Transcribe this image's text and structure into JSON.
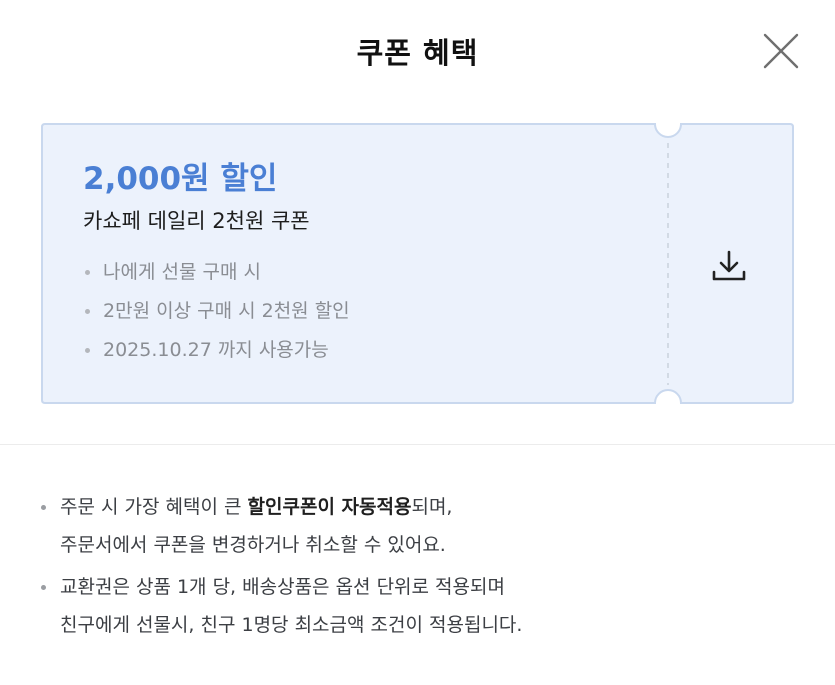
{
  "header": {
    "title": "쿠폰 혜택",
    "close_icon": "close-icon"
  },
  "coupon": {
    "amount_text": "2,000원 할인",
    "name": "카쇼페 데일리 2천원 쿠폰",
    "conditions": [
      "나에게 선물 구매 시",
      "2만원 이상 구매 시 2천원 할인",
      "2025.10.27 까지 사용가능"
    ],
    "download_icon": "download-icon",
    "colors": {
      "background": "#ecf2fc",
      "border": "#c9d8ee",
      "amount": "#4a7fd4"
    }
  },
  "notes": [
    {
      "before": "주문 시 가장 혜택이 큰 ",
      "bold": "할인쿠폰이 자동적용",
      "after": "되며,",
      "line2": "주문서에서 쿠폰을 변경하거나 취소할 수 있어요."
    },
    {
      "line1": "교환권은 상품 1개 당, 배송상품은 옵션 단위로 적용되며",
      "line2": "친구에게 선물시, 친구 1명당 최소금액 조건이 적용됩니다."
    }
  ]
}
